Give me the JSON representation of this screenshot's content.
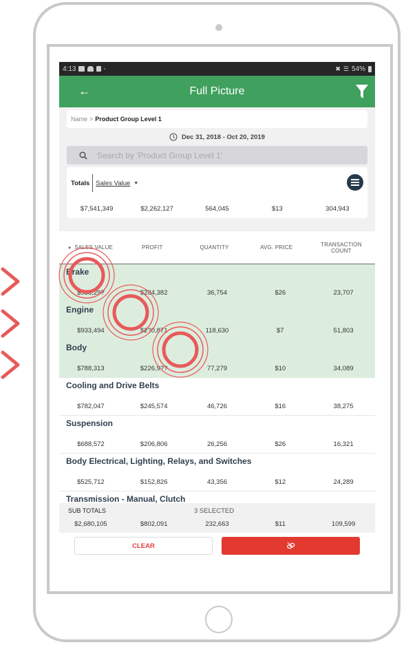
{
  "status_bar": {
    "time": "4:13",
    "battery": "54%",
    "left_icons": [
      "gallery-icon",
      "cloud-icon",
      "sim-icon"
    ],
    "right_icons": [
      "mute-icon",
      "wifi-icon",
      "battery-icon"
    ]
  },
  "app_bar": {
    "title": "Full Picture",
    "back_icon": "arrow-left-icon",
    "filter_icon": "filter-icon"
  },
  "breadcrumb": {
    "root": "Name",
    "separator": ">",
    "current": "Product Group Level 1"
  },
  "date_range": {
    "icon": "history-clock-icon",
    "label": "Dec 31, 2018 - Oct 20, 2019"
  },
  "search": {
    "placeholder": "Search by 'Product Group Level 1'",
    "value": ""
  },
  "totals": {
    "label": "Totals",
    "metric_selector": "Sales Value",
    "values": [
      "$7,541,349",
      "$2,262,127",
      "564,045",
      "$13",
      "304,943"
    ]
  },
  "table": {
    "columns": [
      {
        "label": "SALES VALUE",
        "sorted": true
      },
      {
        "label": "PROFIT",
        "sorted": false
      },
      {
        "label": "QUANTITY",
        "sorted": false
      },
      {
        "label": "AVG. PRICE",
        "sorted": false
      },
      {
        "label": "TRANSACTION COUNT",
        "sorted": false
      }
    ],
    "rows": [
      {
        "name": "Brake",
        "selected": true,
        "values": [
          "$958,29?",
          "$284,382",
          "36,754",
          "$26",
          "23,707"
        ]
      },
      {
        "name": "Engine",
        "selected": true,
        "values": [
          "$933,494",
          "$2?0,871",
          "118,630",
          "$7",
          "51,803"
        ]
      },
      {
        "name": "Body",
        "selected": true,
        "values": [
          "$788,313",
          "$226,9??",
          "77,279",
          "$10",
          "34,089"
        ]
      },
      {
        "name": "Cooling and Drive Belts",
        "selected": false,
        "values": [
          "$782,047",
          "$245,574",
          "46,726",
          "$16",
          "38,275"
        ]
      },
      {
        "name": "Suspension",
        "selected": false,
        "values": [
          "$688,572",
          "$206,806",
          "26,256",
          "$26",
          "16,321"
        ]
      },
      {
        "name": "Body Electrical, Lighting, Relays, and Switches",
        "selected": false,
        "values": [
          "$525,712",
          "$152,826",
          "43,356",
          "$12",
          "24,289"
        ]
      },
      {
        "name": "Transmission - Manual, Clutch",
        "selected": false,
        "values": [
          "",
          "",
          "",
          "",
          ""
        ]
      }
    ]
  },
  "subtotals": {
    "label": "SUB TOTALS",
    "selected_count": "3 SELECTED",
    "values": [
      "$2,680,105",
      "$802,091",
      "232,663",
      "$11",
      "109,599"
    ]
  },
  "actions": {
    "clear_label": "CLEAR",
    "action_icon": "unlink-icon"
  },
  "annotations": {
    "tap_indicator_color": "#e85a5a",
    "chevron_color": "#e85a5a",
    "chevron_count": 3
  },
  "colors": {
    "app_bar": "#40a05e",
    "selected_row": "#dcedde",
    "danger": "#e23a30",
    "status_bar": "#262626"
  }
}
